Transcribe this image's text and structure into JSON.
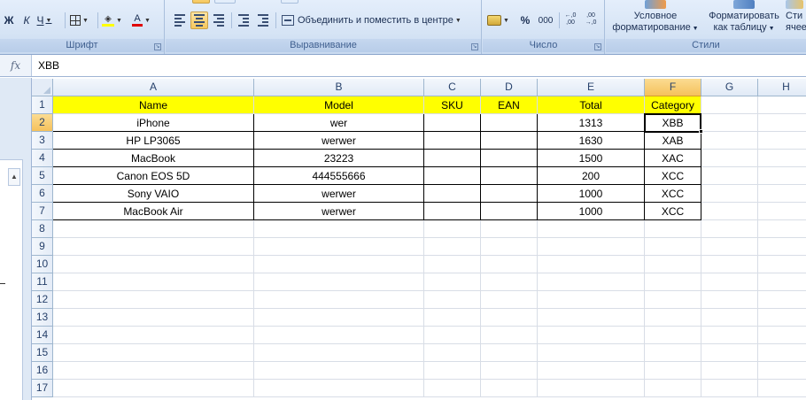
{
  "ribbon": {
    "font_group": {
      "title": "Шрифт",
      "italic": "К",
      "bold": "Ж",
      "underline": "Ч",
      "font_color_letter": "А"
    },
    "align_group": {
      "title": "Выравнивание",
      "merge_label": "Объединить и поместить в центре"
    },
    "number_group": {
      "title": "Число",
      "percent": "%",
      "thousands": "000",
      "inc_decimal": "←,0\n,00",
      "dec_decimal": ",00\n→,0"
    },
    "styles_group": {
      "title": "Стили",
      "conditional_line1": "Условное",
      "conditional_line2": "форматирование",
      "table_line1": "Форматировать",
      "table_line2": "как таблицу",
      "cell_styles_line1": "Сти",
      "cell_styles_line2": "ячее"
    },
    "colors": {
      "fill_color": "#ffff00",
      "font_color": "#e00000"
    }
  },
  "formula_bar": {
    "fx_label": "fx",
    "value": "XBB"
  },
  "grid": {
    "columns": [
      "A",
      "B",
      "C",
      "D",
      "E",
      "F",
      "G",
      "H"
    ],
    "selected_column": "F",
    "selected_row": "2",
    "rows": [
      {
        "num": "1",
        "cells": [
          "Name",
          "Model",
          "SKU",
          "EAN",
          "Total",
          "Category",
          "",
          ""
        ]
      },
      {
        "num": "2",
        "cells": [
          "iPhone",
          "wer",
          "",
          "",
          "1313",
          "XBB",
          "",
          ""
        ]
      },
      {
        "num": "3",
        "cells": [
          "HP LP3065",
          "werwer",
          "",
          "",
          "1630",
          "XAB",
          "",
          ""
        ]
      },
      {
        "num": "4",
        "cells": [
          "MacBook",
          "23223",
          "",
          "",
          "1500",
          "XAC",
          "",
          ""
        ]
      },
      {
        "num": "5",
        "cells": [
          "Canon EOS 5D",
          "444555666",
          "",
          "",
          "200",
          "XCC",
          "",
          ""
        ]
      },
      {
        "num": "6",
        "cells": [
          "Sony VAIO",
          "werwer",
          "",
          "",
          "1000",
          "XCC",
          "",
          ""
        ]
      },
      {
        "num": "7",
        "cells": [
          "MacBook Air",
          "werwer",
          "",
          "",
          "1000",
          "XCC",
          "",
          ""
        ]
      },
      {
        "num": "8",
        "cells": [
          "",
          "",
          "",
          "",
          "",
          "",
          "",
          ""
        ]
      },
      {
        "num": "9",
        "cells": [
          "",
          "",
          "",
          "",
          "",
          "",
          "",
          ""
        ]
      },
      {
        "num": "10",
        "cells": [
          "",
          "",
          "",
          "",
          "",
          "",
          "",
          ""
        ]
      },
      {
        "num": "11",
        "cells": [
          "",
          "",
          "",
          "",
          "",
          "",
          "",
          ""
        ]
      },
      {
        "num": "12",
        "cells": [
          "",
          "",
          "",
          "",
          "",
          "",
          "",
          ""
        ]
      },
      {
        "num": "13",
        "cells": [
          "",
          "",
          "",
          "",
          "",
          "",
          "",
          ""
        ]
      },
      {
        "num": "14",
        "cells": [
          "",
          "",
          "",
          "",
          "",
          "",
          "",
          ""
        ]
      },
      {
        "num": "15",
        "cells": [
          "",
          "",
          "",
          "",
          "",
          "",
          "",
          ""
        ]
      },
      {
        "num": "16",
        "cells": [
          "",
          "",
          "",
          "",
          "",
          "",
          "",
          ""
        ]
      },
      {
        "num": "17",
        "cells": [
          "",
          "",
          "",
          "",
          "",
          "",
          "",
          ""
        ]
      }
    ],
    "header_fill_color": "#ffff00",
    "selection_fill": "#f5c15c"
  }
}
